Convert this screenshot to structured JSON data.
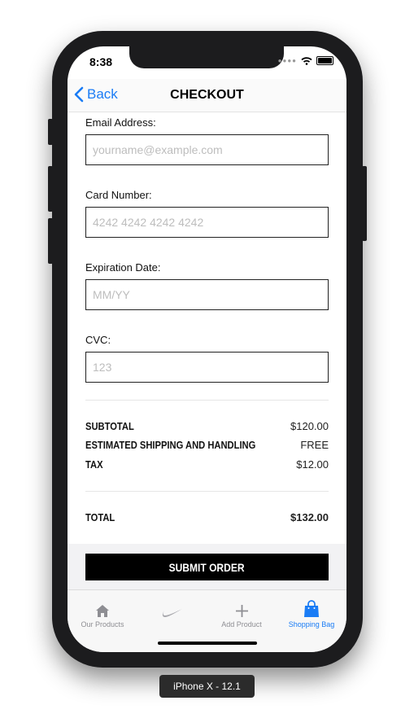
{
  "status_bar": {
    "time": "8:38"
  },
  "nav": {
    "back_label": "Back",
    "title": "CHECKOUT"
  },
  "form": {
    "email": {
      "label": "Email Address:",
      "placeholder": "yourname@example.com"
    },
    "card": {
      "label": "Card Number:",
      "placeholder": "4242 4242 4242 4242"
    },
    "expiry": {
      "label": "Expiration Date:",
      "placeholder": "MM/YY"
    },
    "cvc": {
      "label": "CVC:",
      "placeholder": "123"
    }
  },
  "summary": {
    "subtotal_label": "SUBTOTAL",
    "subtotal_value": "$120.00",
    "shipping_label": "ESTIMATED SHIPPING AND HANDLING",
    "shipping_value": "FREE",
    "tax_label": "TAX",
    "tax_value": "$12.00",
    "total_label": "TOTAL",
    "total_value": "$132.00"
  },
  "submit_label": "SUBMIT ORDER",
  "tabs": [
    {
      "label": "Our Products",
      "icon": "home-icon"
    },
    {
      "label": "",
      "icon": "swoosh-logo-icon"
    },
    {
      "label": "Add Product",
      "icon": "plus-icon"
    },
    {
      "label": "Shopping Bag",
      "icon": "shopping-bag-icon"
    }
  ],
  "device_label": "iPhone X - 12.1",
  "colors": {
    "accent": "#1a7cf5",
    "button": "#000000"
  }
}
